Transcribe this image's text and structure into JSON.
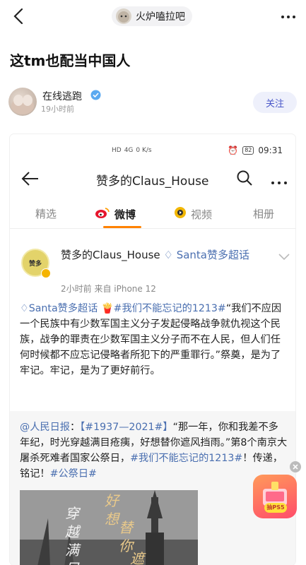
{
  "topbar": {
    "forum_name": "火炉嗑拉吧"
  },
  "post": {
    "title": "这tm也配当中国人"
  },
  "author": {
    "name": "在线逃跑",
    "time": "19小时前",
    "follow_label": "关注"
  },
  "embedded": {
    "status": {
      "network": "HD",
      "net_detail": "4G",
      "speed": "0 K/s",
      "battery": "82",
      "time": "09:31"
    },
    "header_title": "赞多的Claus_House",
    "tabs": [
      {
        "label": "精选",
        "active": false,
        "icon": ""
      },
      {
        "label": "微博",
        "active": true,
        "icon": "weibo-icon"
      },
      {
        "label": "视频",
        "active": false,
        "icon": "video-icon"
      },
      {
        "label": "相册",
        "active": false,
        "icon": ""
      }
    ],
    "weibo_post": {
      "avatar_text": "赞多",
      "name": "赞多的Claus_House",
      "super_tag": "Santa赞多超话",
      "meta": "2小时前   来自 iPhone 12",
      "body_tag": "Santa赞多超话",
      "body_hashtag": "#我们不能忘记的1213#",
      "body_text": "“我们不应因一个民族中有少数军国主义分子发起侵略战争就仇视这个民族，战争的罪责在少数军国主义分子而不在人民，但人们任何时候都不应忘记侵略者所犯下的严重罪行。”祭奠，是为了牢记。牢记，是为了更好前行。"
    },
    "repost": {
      "mention": "@人民日报",
      "hashtag1": "【#1937—2021#】",
      "text1": "“那一年，你和我差不多年纪，时光穿越满目疮痍，好想替你遮风挡雨。”第8个南京大屠杀死难者国家公祭日，",
      "hashtag2": "#我们不能忘记的1213#",
      "text2": "！传递，铭记！",
      "hashtag3": "#公祭日#",
      "image_caption": "穿越满目疮痍 好想替你遮风挡雨"
    }
  },
  "promo": {
    "label": "抽PS5"
  },
  "colors": {
    "accent": "#4a58c9",
    "weibo_link": "#4a6fb0",
    "weibo_orange": "#ff8200"
  }
}
